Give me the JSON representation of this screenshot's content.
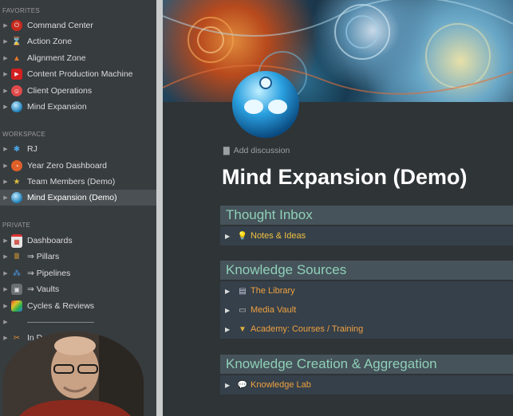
{
  "sidebar": {
    "favorites_label": "FAVORITES",
    "workspace_label": "WORKSPACE",
    "private_label": "PRIVATE",
    "favorites": [
      {
        "label": "Command Center",
        "icon": "red-power-icon"
      },
      {
        "label": "Action Zone",
        "icon": "hourglass-icon"
      },
      {
        "label": "Alignment Zone",
        "icon": "pyramid-icon"
      },
      {
        "label": "Content Production Machine",
        "icon": "play-button-icon"
      },
      {
        "label": "Client Operations",
        "icon": "person-badge-icon"
      },
      {
        "label": "Mind Expansion",
        "icon": "blue-orb-icon"
      }
    ],
    "workspace": [
      {
        "label": "RJ",
        "icon": "snowflake-icon"
      },
      {
        "label": "Year Zero Dashboard",
        "icon": "dial-icon"
      },
      {
        "label": "Team Members (Demo)",
        "icon": "team-icon"
      },
      {
        "label": "Mind Expansion (Demo)",
        "icon": "blue-orb-icon"
      }
    ],
    "private": [
      {
        "label": "Dashboards",
        "icon": "calendar-icon"
      },
      {
        "label": "⇒ Pillars",
        "icon": "pillars-icon"
      },
      {
        "label": "⇒ Pipelines",
        "icon": "pipeline-icon"
      },
      {
        "label": "⇒ Vaults",
        "icon": "vault-icon"
      },
      {
        "label": "Cycles & Reviews",
        "icon": "cycle-icon"
      }
    ],
    "partial": {
      "label": "In D",
      "divider": "————————"
    }
  },
  "main": {
    "add_discussion": "Add discussion",
    "title": "Mind Expansion (Demo)",
    "sections": [
      {
        "heading": "Thought Inbox",
        "rows": [
          {
            "label": "Notes & Ideas",
            "icon": "lightbulb-icon"
          }
        ]
      },
      {
        "heading": "Knowledge Sources",
        "rows": [
          {
            "label": "The Library",
            "icon": "books-icon"
          },
          {
            "label": "Media Vault",
            "icon": "tape-icon"
          },
          {
            "label": "Academy: Courses / Training",
            "icon": "graduation-icon"
          }
        ]
      },
      {
        "heading": "Knowledge Creation & Aggregation",
        "rows": [
          {
            "label": "Knowledge Lab",
            "icon": "speech-bubble-icon"
          }
        ]
      }
    ]
  },
  "colors": {
    "accent_heading": "#8fd0b8",
    "row_text": "#f0c040",
    "sidebar_bg": "#373c3f",
    "main_bg": "#2f3437"
  }
}
